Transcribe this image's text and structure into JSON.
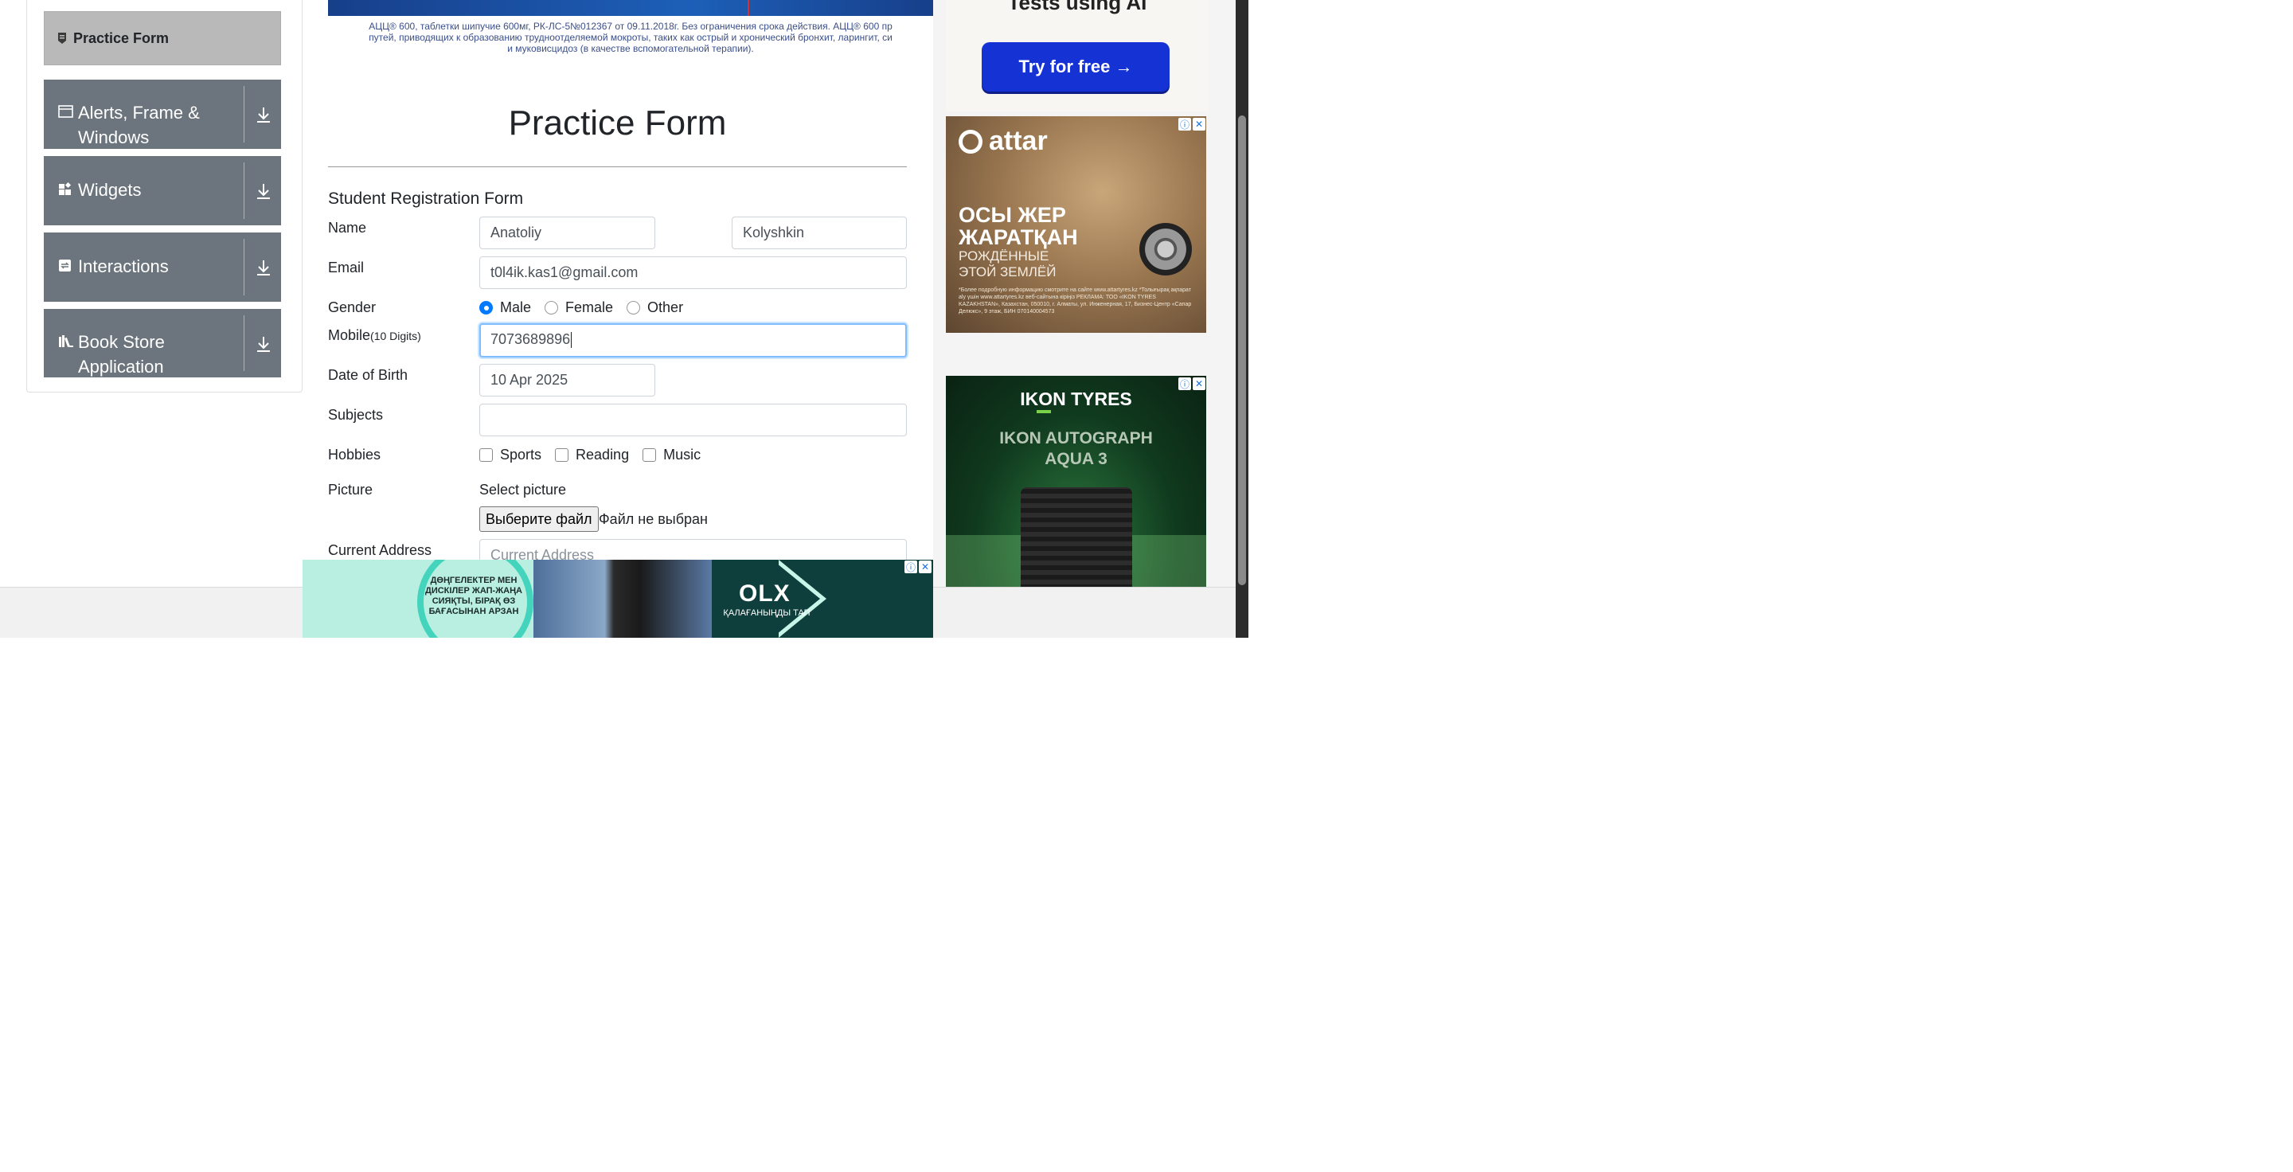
{
  "sidebar": {
    "active_item": "Practice Form",
    "groups": [
      {
        "label": "Alerts, Frame & Windows",
        "line1": "Alerts, Frame &",
        "line2": "Windows",
        "icon": "window-icon"
      },
      {
        "label": "Widgets",
        "icon": "widgets-icon"
      },
      {
        "label": "Interactions",
        "icon": "interactions-icon"
      },
      {
        "label": "Book Store Application",
        "line1": "Book Store",
        "line2": "Application",
        "icon": "books-icon"
      }
    ]
  },
  "banner": {
    "line1": "АЦЦ® 600, таблетки шипучие 600мг, РК-ЛС-5№012367 от 09.11.2018г. Без ограничения срока действия. АЦЦ® 600 пр",
    "line2": "путей, приводящих к образованию трудноотделяемой мокроты, таких как острый и хронический бронхит, ларингит, си",
    "line3": "и муковисцидоз (в качестве вспомогательной терапии)."
  },
  "page": {
    "title": "Practice Form",
    "form_heading": "Student Registration Form"
  },
  "form": {
    "name_label": "Name",
    "first_name": "Anatoliy",
    "last_name": "Kolyshkin",
    "email_label": "Email",
    "email": "t0l4ik.kas1@gmail.com",
    "gender_label": "Gender",
    "gender_options": [
      "Male",
      "Female",
      "Other"
    ],
    "gender_selected": "Male",
    "mobile_label": "Mobile",
    "mobile_hint": "(10 Digits)",
    "mobile": "7073689896",
    "dob_label": "Date of Birth",
    "dob": "10 Apr 2025",
    "subjects_label": "Subjects",
    "subjects": "",
    "hobbies_label": "Hobbies",
    "hobbies": [
      "Sports",
      "Reading",
      "Music"
    ],
    "picture_label": "Picture",
    "select_picture": "Select picture",
    "file_button": "Выберите файл",
    "file_status": "Файл не выбран",
    "address_label": "Current Address",
    "address_placeholder": "Current Address"
  },
  "ads": {
    "ai_heading": "Tests using AI",
    "try_button": "Try for free →",
    "attar": {
      "logo": "attar",
      "headline1": "ОСЫ ЖЕР",
      "headline2": "ЖАРАТҚАН",
      "sub1": "РОЖДЁННЫЕ",
      "sub2": "ЭТОЙ ЗЕМЛЁЙ",
      "fine": "*Более подробную информацию смотрите на сайте www.attartyres.kz  *Толығырақ ақпарат alу үшін www.attartyres.kz веб-сайтына кіріңіз  РЕКЛАМА: ТОО «IKON TYRES KAZAKHSTAN», Казахстан, 050010, г. Алматы, ул. Инженерная, 17, Бизнес-Центр «Сапар Делюкс», 9 этаж, БИН 070140004573"
    },
    "ikon": {
      "brand": "IKON TYRES",
      "model1": "IKON AUTOGRAPH",
      "model2": "AQUA 3"
    },
    "bottom": {
      "text": "ДӨҢГЕЛЕКТЕР МЕН ДИСКІЛЕР ЖАП-ЖАҢА СИЯҚТЫ, БІРАҚ ӨЗ БАҒАСЫНАН АРЗАН",
      "olx": "OLX",
      "olx_tag": "ҚАЛАҒАНЫҢДЫ ТАП"
    },
    "info_glyph": "ⓘ",
    "close_glyph": "✕"
  }
}
